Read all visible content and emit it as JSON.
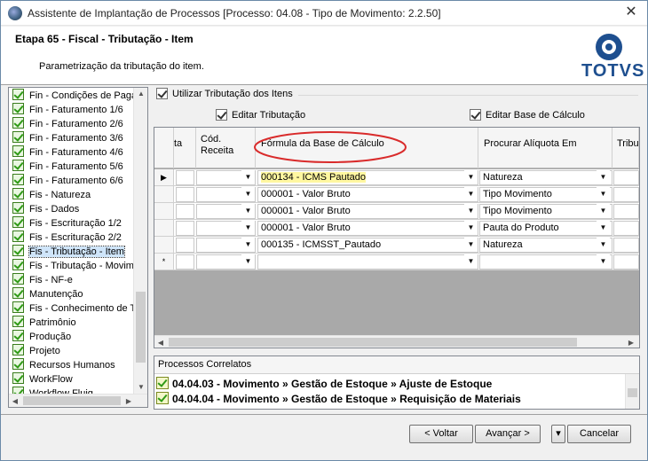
{
  "window": {
    "title": "Assistente de Implantação de Processos [Processo: 04.08 - Tipo de Movimento: 2.2.50]",
    "close_glyph": "✕"
  },
  "header": {
    "step_title": "Etapa 65 - Fiscal - Tributação - Item",
    "subtitle": "Parametrização da tributação do item.",
    "logo_text": "TOTVS"
  },
  "sidebar": {
    "items": [
      {
        "label": "Fin - Condições de Paga"
      },
      {
        "label": "Fin - Faturamento 1/6"
      },
      {
        "label": "Fin - Faturamento 2/6"
      },
      {
        "label": "Fin - Faturamento 3/6"
      },
      {
        "label": "Fin - Faturamento 4/6"
      },
      {
        "label": "Fin - Faturamento 5/6"
      },
      {
        "label": "Fin - Faturamento 6/6"
      },
      {
        "label": "Fis - Natureza"
      },
      {
        "label": "Fis - Dados"
      },
      {
        "label": "Fis - Escrituração 1/2"
      },
      {
        "label": "Fis - Escrituração 2/2"
      },
      {
        "label": "Fis - Tributação - Item"
      },
      {
        "label": "Fis - Tributação - Movim"
      },
      {
        "label": "Fis - NF-e"
      },
      {
        "label": "Manutenção"
      },
      {
        "label": "Fis - Conhecimento de T"
      },
      {
        "label": "Patrimônio"
      },
      {
        "label": "Produção"
      },
      {
        "label": "Projeto"
      },
      {
        "label": "Recursos Humanos"
      },
      {
        "label": "WorkFlow"
      },
      {
        "label": "Workflow Fluig"
      }
    ],
    "selected_index": 11
  },
  "options": {
    "utilizar_tributacao": "Utilizar Tributação dos Itens",
    "editar_tributacao": "Editar Tributação",
    "editar_base_calculo": "Editar Base de Cálculo"
  },
  "grid": {
    "columns": [
      "ta",
      "Cód. Receita",
      "Fórmula da Base de Cálculo",
      "Procurar Alíquota Em",
      "Tribu"
    ],
    "rows": [
      {
        "marker": "▶",
        "formula": "000134 - ICMS Pautado",
        "aliquota": "Natureza"
      },
      {
        "marker": "",
        "formula": "000001 - Valor Bruto",
        "aliquota": "Tipo Movimento"
      },
      {
        "marker": "",
        "formula": "000001 - Valor Bruto",
        "aliquota": "Tipo Movimento"
      },
      {
        "marker": "",
        "formula": "000001 - Valor Bruto",
        "aliquota": "Pauta do Produto"
      },
      {
        "marker": "",
        "formula": "000135 - ICMSST_Pautado",
        "aliquota": "Natureza"
      },
      {
        "marker": "*",
        "formula": "",
        "aliquota": ""
      }
    ],
    "annotation_color": "#d92b2b"
  },
  "related": {
    "title": "Processos Correlatos",
    "items": [
      {
        "label": "04.04.03 - Movimento » Gestão de Estoque » Ajuste de Estoque"
      },
      {
        "label": "04.04.04 - Movimento » Gestão de Estoque » Requisição de Materiais"
      }
    ]
  },
  "footer": {
    "back": "< Voltar",
    "next": "Avançar >",
    "more": "▾",
    "cancel": "Cancelar"
  }
}
